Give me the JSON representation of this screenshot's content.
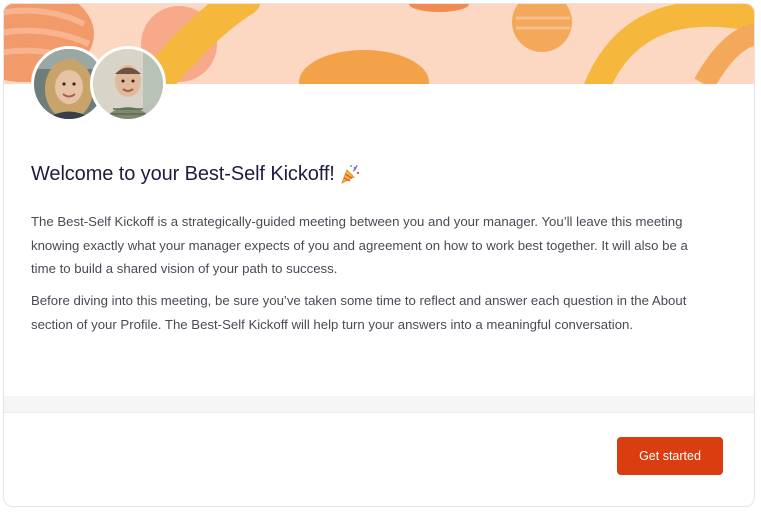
{
  "welcome": {
    "title": "Welcome to your Best-Self Kickoff!",
    "title_emoji_icon": "party-popper-icon",
    "paragraphs": [
      "The Best-Self Kickoff is a strategically-guided meeting between you and your manager. You’ll leave this meeting knowing exactly what your manager expects of you and agreement on how to work best together. It will also be a time to build a shared vision of your path to success.",
      "Before diving into this meeting, be sure you’ve taken some time to reflect and answer each question in the About section of your Profile. The Best-Self Kickoff will help turn your answers into a meaningful conversation."
    ]
  },
  "footer": {
    "get_started_label": "Get started"
  },
  "colors": {
    "banner_background": "#fcd8c2",
    "banner_accent_orange": "#f28b50",
    "banner_accent_yellow": "#f5b83d",
    "title_text": "#1f1d3d",
    "body_text": "#4a4a55",
    "primary_button": "#d93d10"
  }
}
